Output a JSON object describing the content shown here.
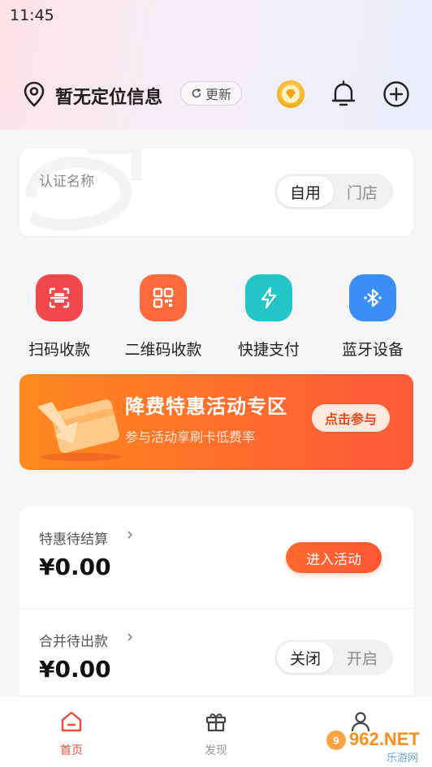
{
  "status_bar": {
    "time": "11:45"
  },
  "header": {
    "location_text": "暂无定位信息",
    "refresh_label": "更新"
  },
  "auth_card": {
    "label": "认证名称",
    "options": [
      "自用",
      "门店"
    ],
    "selected": "自用"
  },
  "quick_actions": [
    {
      "label": "扫码收款",
      "icon": "scan-icon",
      "color": "#f2474b"
    },
    {
      "label": "二维码收款",
      "icon": "qrcode-icon",
      "color": "#ff6a3c"
    },
    {
      "label": "快捷支付",
      "icon": "lightning-icon",
      "color": "#22c6c6"
    },
    {
      "label": "蓝牙设备",
      "icon": "bluetooth-icon",
      "color": "#3a8ff7"
    }
  ],
  "banner": {
    "title": "降费特惠活动专区",
    "subtitle": "参与活动享刷卡低费率",
    "button": "点击参与"
  },
  "funds": {
    "pending_settlement": {
      "label": "特惠待结算",
      "amount": "¥0.00",
      "button": "进入活动"
    },
    "merged_payout": {
      "label": "合并待出款",
      "amount": "¥0.00",
      "options": [
        "关闭",
        "开启"
      ],
      "selected": "关闭"
    }
  },
  "tabbar": {
    "items": [
      {
        "label": "首页",
        "active": true
      },
      {
        "label": "发现",
        "active": false
      },
      {
        "label": "",
        "active": false
      }
    ]
  },
  "watermark": {
    "text": "962.NET",
    "subtext": "乐游网"
  },
  "colors": {
    "accent": "#ff5a30",
    "tab_active": "#f04a3a"
  }
}
